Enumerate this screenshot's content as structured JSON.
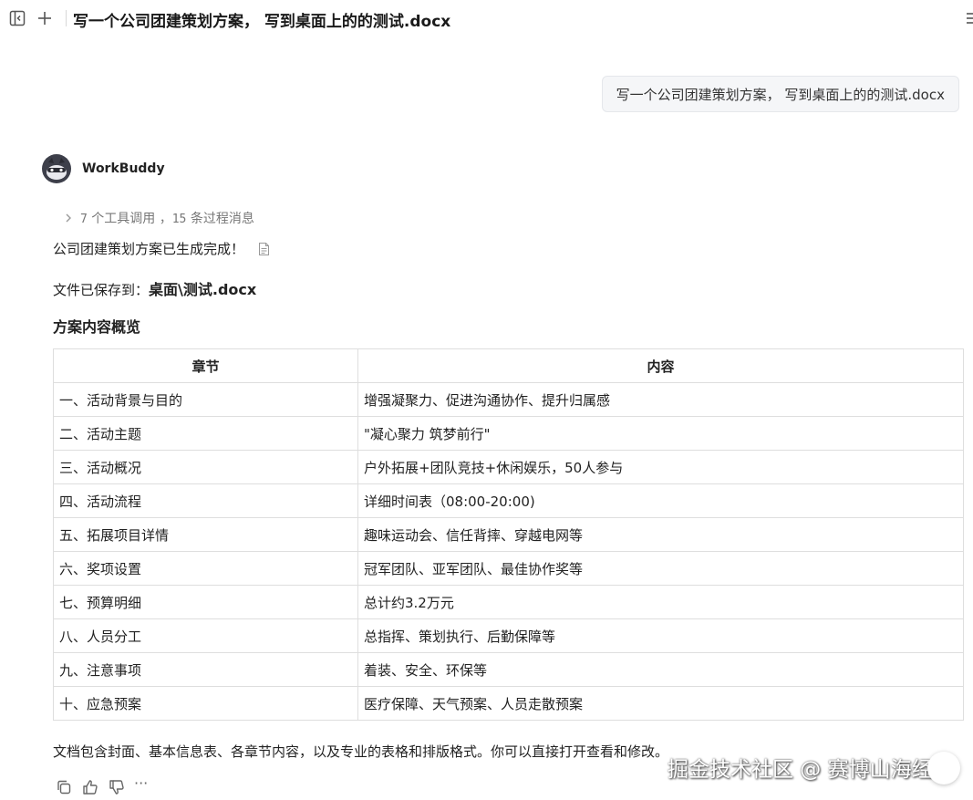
{
  "header": {
    "title": "写一个公司团建策划方案， 写到桌面上的的测试.docx"
  },
  "user_message": {
    "text": "写一个公司团建策划方案， 写到桌面上的的测试.docx"
  },
  "agent": {
    "name": "WorkBuddy",
    "tool_calls_count": "7",
    "tool_calls_label": "个工具调用",
    "separator": "，",
    "process_count": "15",
    "process_label": "条过程消息",
    "done_text": "公司团建策划方案已生成完成！",
    "saved_prefix": "文件已保存到：",
    "saved_path": "桌面\\测试.docx",
    "overview_heading": "方案内容概览",
    "table": {
      "headers": [
        "章节",
        "内容"
      ],
      "rows": [
        [
          "一、活动背景与目的",
          "增强凝聚力、促进沟通协作、提升归属感"
        ],
        [
          "二、活动主题",
          "\"凝心聚力 筑梦前行\""
        ],
        [
          "三、活动概况",
          "户外拓展+团队竞技+休闲娱乐，50人参与"
        ],
        [
          "四、活动流程",
          "详细时间表（08:00-20:00)"
        ],
        [
          "五、拓展项目详情",
          "趣味运动会、信任背摔、穿越电网等"
        ],
        [
          "六、奖项设置",
          "冠军团队、亚军团队、最佳协作奖等"
        ],
        [
          "七、预算明细",
          "总计约3.2万元"
        ],
        [
          "八、人员分工",
          "总指挥、策划执行、后勤保障等"
        ],
        [
          "九、注意事项",
          "着装、安全、环保等"
        ],
        [
          "十、应急预案",
          "医疗保障、天气预案、人员走散预案"
        ]
      ]
    },
    "footer_text": "文档包含封面、基本信息表、各章节内容，以及专业的表格和排版格式。你可以直接打开查看和修改。"
  },
  "actions": {
    "more_label": "···"
  },
  "watermark": "掘金技术社区 @ 赛博山海经",
  "icons": {
    "sidebar_toggle": "sidebar-toggle-icon",
    "new_chat": "plus-icon",
    "menu": "menu-icon",
    "tool_expand": "chevron-right-icon",
    "file": "file-icon",
    "copy": "copy-icon",
    "like": "thumbs-up-icon",
    "dislike": "thumbs-down-icon"
  }
}
